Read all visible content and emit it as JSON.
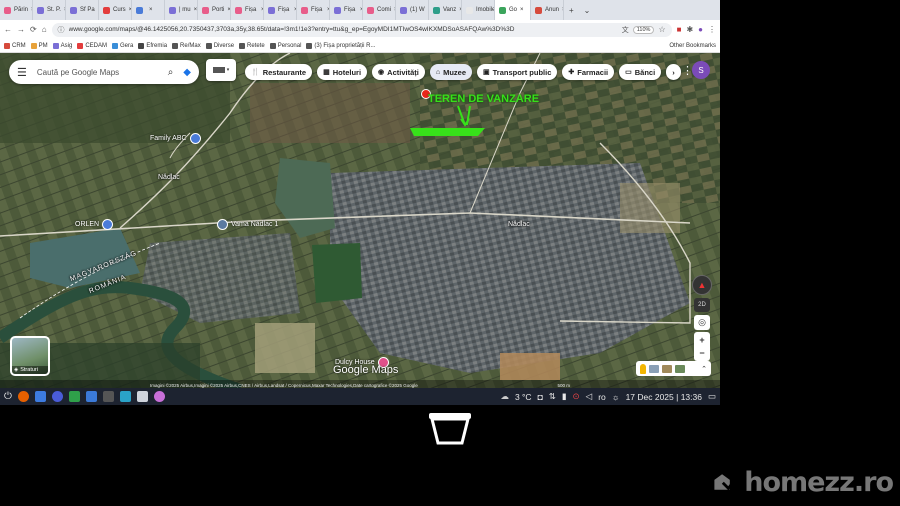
{
  "browser": {
    "tabs": [
      {
        "label": "Părin",
        "color": "#e85d8a"
      },
      {
        "label": "St. P.",
        "color": "#7b6fd6"
      },
      {
        "label": "Sf Pa",
        "color": "#7b6fd6"
      },
      {
        "label": "Curs",
        "color": "#e33c3c"
      },
      {
        "label": "",
        "color": "#4a7bd8"
      },
      {
        "label": "| mu",
        "color": "#7b6fd6"
      },
      {
        "label": "Porti",
        "color": "#e85d8a"
      },
      {
        "label": "Fișa ⁠",
        "color": "#e85d8a"
      },
      {
        "label": "Fișa ⁠",
        "color": "#7b6fd6"
      },
      {
        "label": "Fișa ⁠",
        "color": "#e85d8a"
      },
      {
        "label": "Fișa ⁠",
        "color": "#7b6fd6"
      },
      {
        "label": "Comi",
        "color": "#e85d8a"
      },
      {
        "label": "(1) W",
        "color": "#7b6fd6"
      },
      {
        "label": "Vanz",
        "color": "#2e9e8a"
      },
      {
        "label": "Imobile",
        "color": "#e8e8e8"
      },
      {
        "label": "Go",
        "color": "#3ba55c",
        "active": true
      },
      {
        "label": "Anun",
        "color": "#d64a3c"
      }
    ],
    "url": "www.google.com/maps/@46.1425056,20.7350437,3703a,35y,38.65t/data=!3m1!1e3?entry=ttu&g_ep=EgoyMDI1MTIwOS4wIKXMDSoASAFQAw%3D%3D",
    "zoom": "110%",
    "bookmarks": [
      "CRM",
      "PM",
      "Asig",
      "CEDAM",
      "Gera",
      "Efremia",
      "Re/Max",
      "Diverse",
      "Retete",
      "Personal",
      "(3) Fișa proprietății R..."
    ],
    "other_bookmarks": "Other Bookmarks"
  },
  "maps": {
    "search_placeholder": "Caută pe Google Maps",
    "chips": [
      "Restaurante",
      "Hoteluri",
      "Activități",
      "Muzee",
      "Transport public",
      "Farmacii",
      "Bănci"
    ],
    "avatar_initial": "S",
    "labels": {
      "family": "Family ABC",
      "nadlac_west": "Nădlac",
      "nadlac_town": "Nădlac",
      "orlen": "ORLEN",
      "vama": "Vama Nădlac 1",
      "magyarorszag": "MAGYARORSZÁG",
      "romania": "ROMÂNIA",
      "dulcy": "Dulcy House"
    },
    "annotation": "TEREN DE VANZARE",
    "streetview_label": "Straturi",
    "btn_2d": "2D",
    "logo": "Google Maps",
    "attribution": "Imagini ©2025 Airbus,Imagini ©2025 Airbus,CNES / Airbus,Landsat / Copernicus,Maxar Technologies,Date cartografice ©2025 Google",
    "scale": "500 m"
  },
  "taskbar": {
    "temperature": "3 °C",
    "lang": "ro",
    "datetime": "17 Dec 2025 | 13:36"
  },
  "watermark": "homezz.ro"
}
